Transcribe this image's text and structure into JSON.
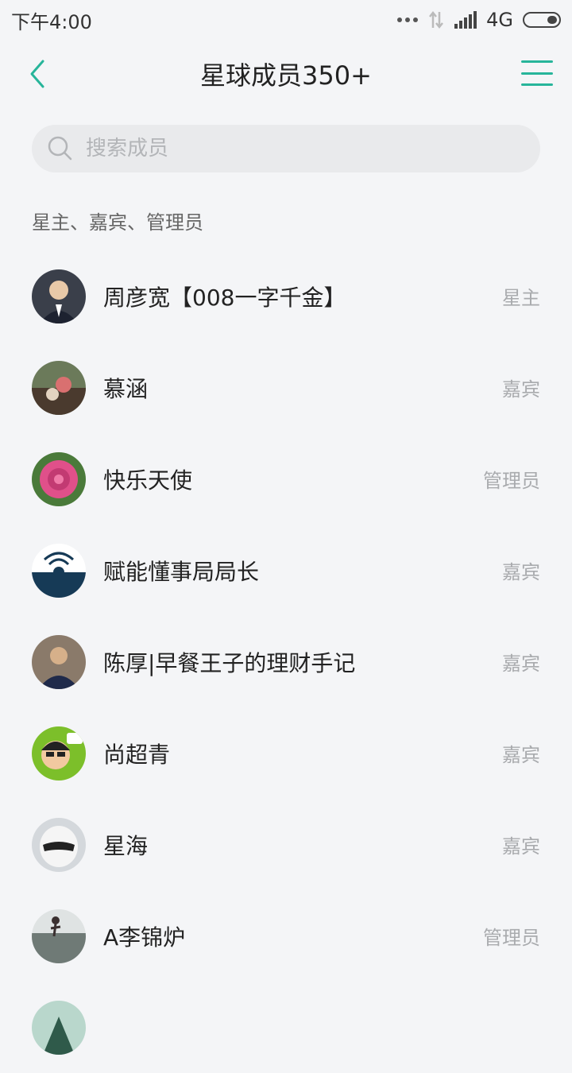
{
  "status_bar": {
    "time": "下午4:00",
    "network": "4G",
    "icons": [
      "more-dots-icon",
      "data-arrows-icon",
      "signal-icon",
      "battery-icon"
    ]
  },
  "nav": {
    "title": "星球成员350+",
    "back_icon": "chevron-left-icon",
    "menu_icon": "hamburger-menu-icon",
    "accent_color": "#27b59a"
  },
  "search": {
    "placeholder": "搜索成员",
    "value": "",
    "icon": "search-icon"
  },
  "section": {
    "label": "星主、嘉宾、管理员"
  },
  "members": [
    {
      "name": "周彦宽【008一字千金】",
      "role": "星主",
      "avatar_color": "#3a3f4a"
    },
    {
      "name": "慕涵",
      "role": "嘉宾",
      "avatar_color": "#6b5a4a"
    },
    {
      "name": "快乐天使",
      "role": "管理员",
      "avatar_color": "#d6457a"
    },
    {
      "name": "赋能懂事局局长",
      "role": "嘉宾",
      "avatar_color": "#163a56"
    },
    {
      "name": "陈厚|早餐王子的理财手记",
      "role": "嘉宾",
      "avatar_color": "#5a5f6b"
    },
    {
      "name": "尚超青",
      "role": "嘉宾",
      "avatar_color": "#7cbf2a"
    },
    {
      "name": "星海",
      "role": "嘉宾",
      "avatar_color": "#c9ced4"
    },
    {
      "name": "A李锦炉",
      "role": "管理员",
      "avatar_color": "#8a9090"
    },
    {
      "name": "",
      "role": "",
      "avatar_color": "#b9d7cc"
    }
  ]
}
